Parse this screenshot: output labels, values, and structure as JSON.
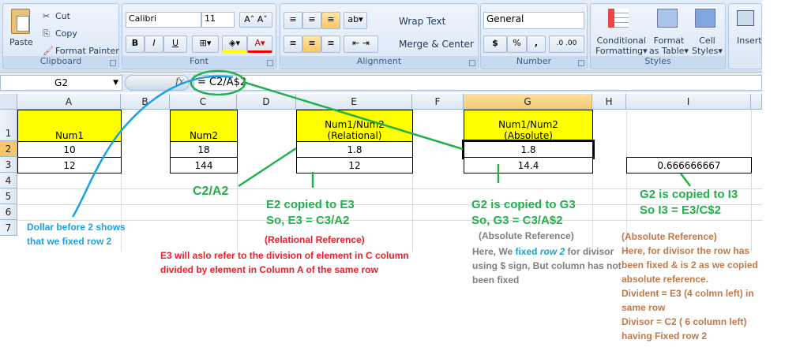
{
  "ribbon": {
    "clipboard": {
      "label": "Clipboard",
      "paste": "Paste",
      "cut": "Cut",
      "copy": "Copy",
      "format_painter": "Format Painter"
    },
    "font": {
      "label": "Font",
      "font_name": "Calibri",
      "font_size": "11",
      "bold": "B",
      "italic": "I",
      "underline": "U"
    },
    "alignment": {
      "label": "Alignment",
      "wrap_text": "Wrap Text",
      "merge_center": "Merge & Center"
    },
    "number": {
      "label": "Number",
      "format": "General",
      "currency": "$",
      "percent": "%",
      "comma": ","
    },
    "styles": {
      "label": "Styles",
      "conditional": "Conditional",
      "conditional2": "Formatting",
      "format_table": "Format",
      "format_table2": "as Table",
      "cell_styles": "Cell",
      "cell_styles2": "Styles"
    },
    "cells": {
      "insert": "Insert"
    }
  },
  "formula_bar": {
    "name_box": "G2",
    "fx": "fx",
    "formula": "= C2/A$2"
  },
  "columns": [
    "A",
    "B",
    "C",
    "D",
    "E",
    "F",
    "G",
    "H",
    "I"
  ],
  "rows": [
    "1",
    "2",
    "3",
    "4",
    "5",
    "6",
    "7"
  ],
  "cells": {
    "A1": "Num1",
    "A2": "10",
    "A3": "12",
    "C1": "Num2",
    "C2": "18",
    "C3": "144",
    "E1a": "Num1/Num2",
    "E1b": "(Relational)",
    "E2": "1.8",
    "E3": "12",
    "G1a": "Num1/Num2",
    "G1b": "(Absolute)",
    "G2": "1.8",
    "G3": "14.4",
    "I3": "0.666666667"
  },
  "annotations": {
    "dollar": [
      "Dollar before 2 shows",
      "that we fixed row 2"
    ],
    "c2a2": "C2/A2",
    "e_copy": [
      "E2 copied to E3",
      "So, E3 = C3/A2"
    ],
    "relational_title": "(Relational Reference)",
    "relational_desc": [
      "E3 will aslo refer to the division of element in C column",
      "divided by element in Column A of the same row"
    ],
    "g_copy": [
      "G2 is copied to G3",
      "So, G3 = C3/A$2"
    ],
    "absolute_title": "(Absolute Reference)",
    "absolute_desc": {
      "pre": "Here, We ",
      "fixed": "fixed ",
      "row": "row 2",
      "post": " for divisor",
      "line2": "using $ sign, But column has not",
      "line3": "been fixed"
    },
    "i_copy": [
      "G2 is copied to I3",
      "So I3 = E3/C$2"
    ],
    "i_desc": [
      "(Absolute Reference)",
      "Here, for divisor the row has",
      "been fixed & is 2 as we copied",
      "absolute reference.",
      "Divident = E3 (4 colmn left) in",
      "same row",
      "Divisor = C2 ( 6 column left)",
      "having Fixed row 2"
    ]
  },
  "colors": {
    "yellow": "#ffff00",
    "green": "#22b04b",
    "blue": "#1ba1e2",
    "red": "#e8202a",
    "gray": "#7f7f7f",
    "brown": "#c0784a"
  }
}
